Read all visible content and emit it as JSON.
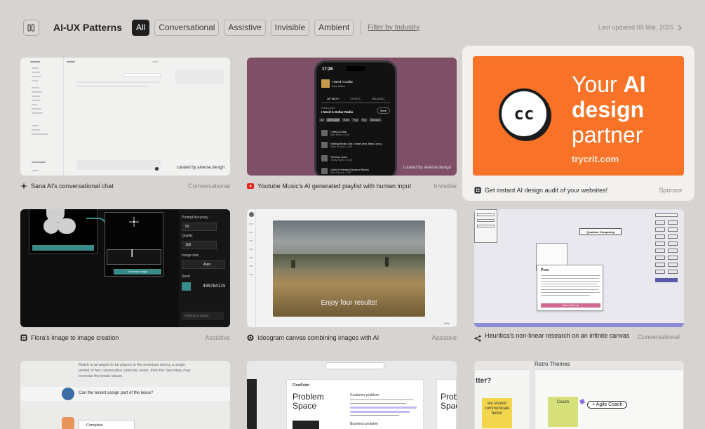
{
  "header": {
    "brand": "AI-UX Patterns",
    "filters": [
      "All",
      "Conversational",
      "Assistive",
      "Invisible",
      "Ambient"
    ],
    "active_filter": "All",
    "filter_link": "Filter by Industry",
    "last_updated": "Last updated 09 Mar, 2025"
  },
  "cards": [
    {
      "title": "Sana AI's conversational chat",
      "tag": "Conversational",
      "icon": "sparkle-icon",
      "watermark": "curated by alverse.design"
    },
    {
      "title": "Youtube Music's AI generated playlist with human input",
      "tag": "Invisible",
      "icon": "youtube-icon",
      "watermark": "curated by alverse.design"
    },
    {
      "title": "Get instant AI design audit of your websites!",
      "tag": "Sponsor",
      "icon": "crit-logo-icon"
    },
    {
      "title": "Flora's image to image creation",
      "tag": "Assistive",
      "icon": "flora-icon"
    },
    {
      "title": "Ideogram canvas combining images with AI",
      "tag": "Assistive",
      "icon": "ideogram-icon"
    },
    {
      "title": "Heuritica's non-linear research on an infinite canvas",
      "tag": "Conversational",
      "icon": "share-nodes-icon"
    }
  ],
  "sana_mock": {
    "prompt": "Can the tenant assign part of the lease?"
  },
  "youtube_mock": {
    "time": "17:26",
    "now_playing_title": "I Need A Dollar",
    "now_playing_artist": "Aloe Blacc",
    "tabs": [
      "UP NEXT",
      "LYRICS",
      "RELATED"
    ],
    "playing_from_label": "Playing from",
    "playing_from": "I Need A Dollar Radio",
    "save": "Save",
    "chips": [
      "All",
      "Alternative",
      "Rock",
      "Pop",
      "Pop",
      "Standard"
    ],
    "queue": [
      {
        "title": "I Need A Dollar",
        "meta": "Aloe Blacc • 4:04"
      },
      {
        "title": "Nothing Breaks Like a Heart (feat. Miley Cyrus)",
        "meta": "Mark Ronson • 3:38"
      },
      {
        "title": "The Door (Live)",
        "meta": "Teddy Swims • 3:35"
      },
      {
        "title": "Catch & Release (Deepend Remix)",
        "meta": "Matt Simons • 3:59"
      }
    ]
  },
  "crit_ad": {
    "line1_plain": "Your",
    "line1_bold": "AI",
    "line2": "design",
    "line3": "partner",
    "url": "trycrit.com",
    "logo": "cc"
  },
  "flora_mock": {
    "prompt_accuracy_label": "Prompt Accuracy",
    "prompt_accuracy_value": "50",
    "quality_label": "Quality",
    "quality_value": "100",
    "image_size_label": "Image size",
    "image_size_value": "Auto",
    "seed_label": "Seed",
    "seed_value": "490784125",
    "export_label": "Nothing to export",
    "generate_label": "Generate image"
  },
  "ideogram_mock": {
    "photo_caption": "Enjoy four results!",
    "zoom": "90%"
  },
  "heuritica_mock": {
    "node_title": "Quantum Computing",
    "dialog_title": "Pros",
    "button_label": "Ask a follow-up"
  },
  "bottom_row": {
    "tenant_text": "Match is arranged to be played at the premises during a single period of two consecutive calendar years, then the Secretary may exercise the break clause.",
    "tenant_question": "Can the tenant assign part of the lease?",
    "tenant_complete": "Complete",
    "fp_brand": "FlowPoint",
    "fp_title": "Problem Space",
    "fp_title_right": "Prob Spac",
    "fp_section": "Customer problem",
    "fp_section2": "Business problem",
    "retro_title": "Retro Themes",
    "retro_left": "tter?",
    "retro_sticky1": "we should communicate better",
    "retro_sticky2": "Coach",
    "agile_label": "Agile Coach"
  },
  "colors": {
    "background": "#d6d3d0",
    "crit_orange": "#f87327",
    "youtube_red": "#e62117",
    "yt_bg": "#7f4f67"
  }
}
